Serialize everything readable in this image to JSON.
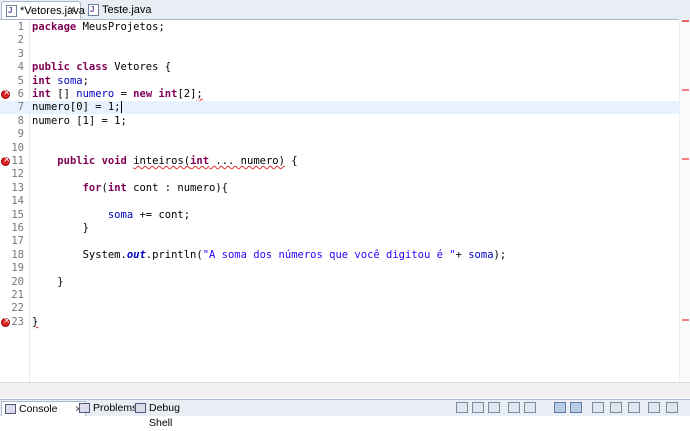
{
  "editor_tabs": [
    {
      "label": "*Vetores.java",
      "close": "✕",
      "active": true
    },
    {
      "label": "Teste.java",
      "active": false
    }
  ],
  "code_lines": [
    {
      "num": "1",
      "html": "<span class=\"kw\">package</span> MeusProjetos;"
    },
    {
      "num": "2",
      "html": ""
    },
    {
      "num": "3",
      "html": ""
    },
    {
      "num": "4",
      "html": "<span class=\"kw\">public</span> <span class=\"kw\">class</span> Vetores {"
    },
    {
      "num": "5",
      "html": "<span class=\"kw\">int</span> <span class=\"fld\">soma</span>;"
    },
    {
      "num": "6",
      "html": "<span class=\"kw\">int</span> [] <span class=\"fld\">numero</span> = <span class=\"kw\">new</span> <span class=\"kw\">int</span>[2]<span class=\"err\">;</span>",
      "error": true
    },
    {
      "num": "7",
      "html": "numero[0] = 1;<span class=\"caret\"></span>",
      "current": true
    },
    {
      "num": "8",
      "html": "numero [1] = 1;"
    },
    {
      "num": "9",
      "html": ""
    },
    {
      "num": "10",
      "html": ""
    },
    {
      "num": "11",
      "html": "    <span class=\"kw\">public</span> <span class=\"kw\">void</span> <span class=\"err\">inteiros(<span class=\"kw\">int</span> ... numero)</span> {",
      "error": true
    },
    {
      "num": "12",
      "html": ""
    },
    {
      "num": "13",
      "html": "        <span class=\"kw\">for</span>(<span class=\"kw\">int</span> cont : numero){"
    },
    {
      "num": "14",
      "html": ""
    },
    {
      "num": "15",
      "html": "            <span class=\"fld\">soma</span> += cont;"
    },
    {
      "num": "16",
      "html": "        }"
    },
    {
      "num": "17",
      "html": ""
    },
    {
      "num": "18",
      "html": "        System.<span class=\"stat\">out</span>.println(<span class=\"str\">\"A soma dos números que você digitou é \"</span>+ <span class=\"fld\">soma</span>);"
    },
    {
      "num": "19",
      "html": ""
    },
    {
      "num": "20",
      "html": "    }"
    },
    {
      "num": "21",
      "html": ""
    },
    {
      "num": "22",
      "html": ""
    },
    {
      "num": "23",
      "html": "<span class=\"err\">}</span>",
      "error": true
    }
  ],
  "bottom_tabs": [
    {
      "label": "Console",
      "close": "✕",
      "active": true
    },
    {
      "label": "Problems",
      "active": false
    },
    {
      "label": "Debug Shell",
      "active": false
    }
  ],
  "colors": {
    "keyword": "#7f0055",
    "field": "#0000c0",
    "string": "#2a00ff",
    "error": "#d22222",
    "current_line": "#e8f2fe"
  }
}
